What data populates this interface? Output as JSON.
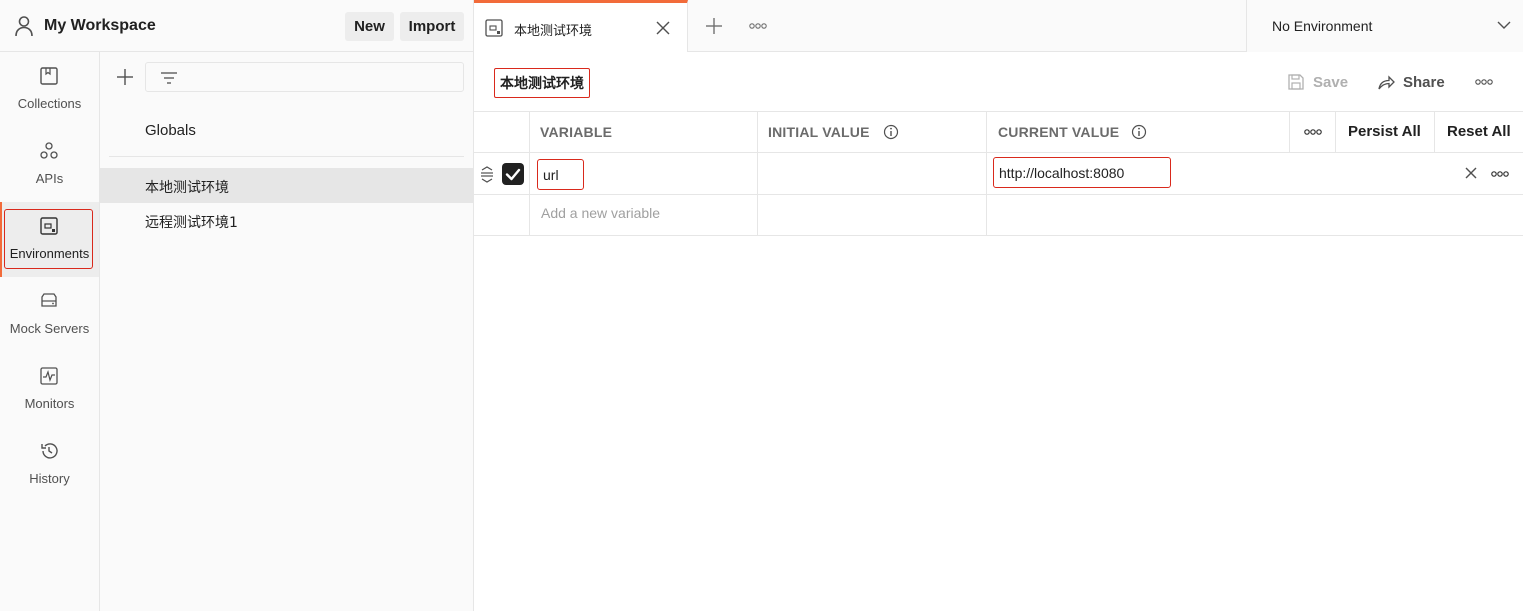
{
  "workspace": {
    "title": "My Workspace",
    "new_label": "New",
    "import_label": "Import"
  },
  "nav": {
    "items": [
      {
        "label": "Collections",
        "icon": "collections-icon"
      },
      {
        "label": "APIs",
        "icon": "apis-icon"
      },
      {
        "label": "Environments",
        "icon": "environments-icon",
        "active": true
      },
      {
        "label": "Mock Servers",
        "icon": "mock-servers-icon"
      },
      {
        "label": "Monitors",
        "icon": "monitors-icon"
      },
      {
        "label": "History",
        "icon": "history-icon"
      }
    ]
  },
  "env_list": {
    "search_placeholder": "",
    "globals_label": "Globals",
    "environments": [
      {
        "name": "本地测试环境",
        "active": true
      },
      {
        "name": "远程测试环境1",
        "active": false
      }
    ]
  },
  "tabs": {
    "open_tab_label": "本地测试环境",
    "environment_selector": "No Environment"
  },
  "env_header": {
    "name": "本地测试环境",
    "save_label": "Save",
    "share_label": "Share"
  },
  "table": {
    "headers": {
      "variable": "VARIABLE",
      "initial_value": "INITIAL VALUE",
      "current_value": "CURRENT VALUE",
      "persist_all": "Persist All",
      "reset_all": "Reset All"
    },
    "rows": [
      {
        "enabled": true,
        "variable": "url",
        "initial_value": "",
        "current_value": "http://localhost:8080"
      }
    ],
    "new_variable_placeholder": "Add a new variable"
  },
  "colors": {
    "accent": "#f26b3a",
    "highlight_border": "#d9291c",
    "checkbox": "#212121"
  }
}
